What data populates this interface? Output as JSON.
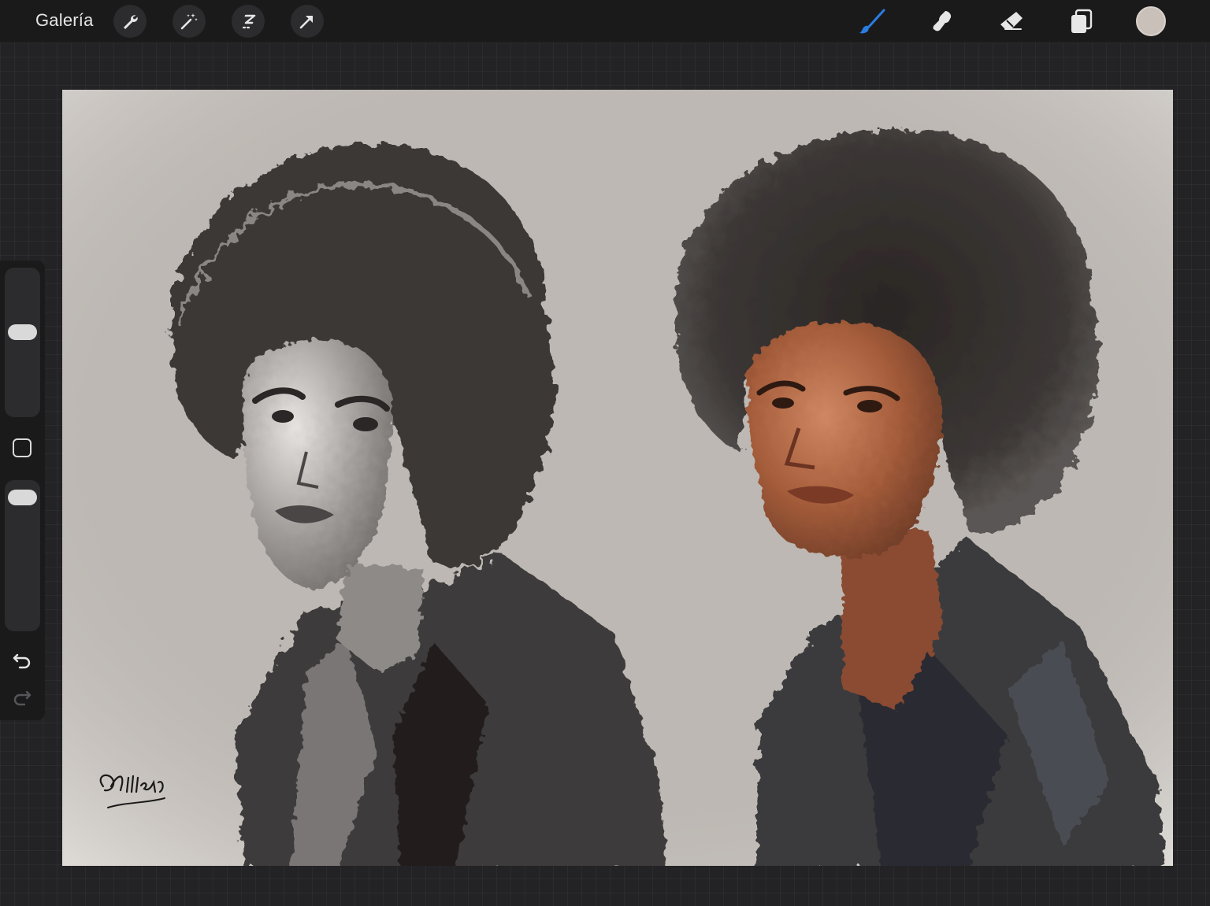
{
  "topbar": {
    "gallery_label": "Galería",
    "left_tools": [
      {
        "name": "actions-wrench-icon"
      },
      {
        "name": "adjustments-magic-wand-icon"
      },
      {
        "name": "selection-icon"
      },
      {
        "name": "transform-arrow-icon"
      }
    ],
    "right_tools": [
      {
        "name": "brush-icon",
        "active": true
      },
      {
        "name": "smudge-icon",
        "active": false
      },
      {
        "name": "eraser-icon",
        "active": false
      },
      {
        "name": "layers-icon",
        "active": false
      }
    ],
    "current_color": "#c9c0ba",
    "active_color": "#2a7de1"
  },
  "sidebar": {
    "brush_size_level": 0.58,
    "opacity_level": 0.95,
    "modifier_icon": "square-modifier-icon",
    "undo_icon": "undo-icon",
    "redo_icon": "redo-icon",
    "redo_enabled": false
  },
  "canvas": {
    "background_color": "#bdb8b3",
    "artwork": [
      {
        "name": "graphite-portrait",
        "style": "grayscale sketch"
      },
      {
        "name": "painted-portrait",
        "style": "color oil paint"
      }
    ],
    "signature": "QSillers"
  }
}
